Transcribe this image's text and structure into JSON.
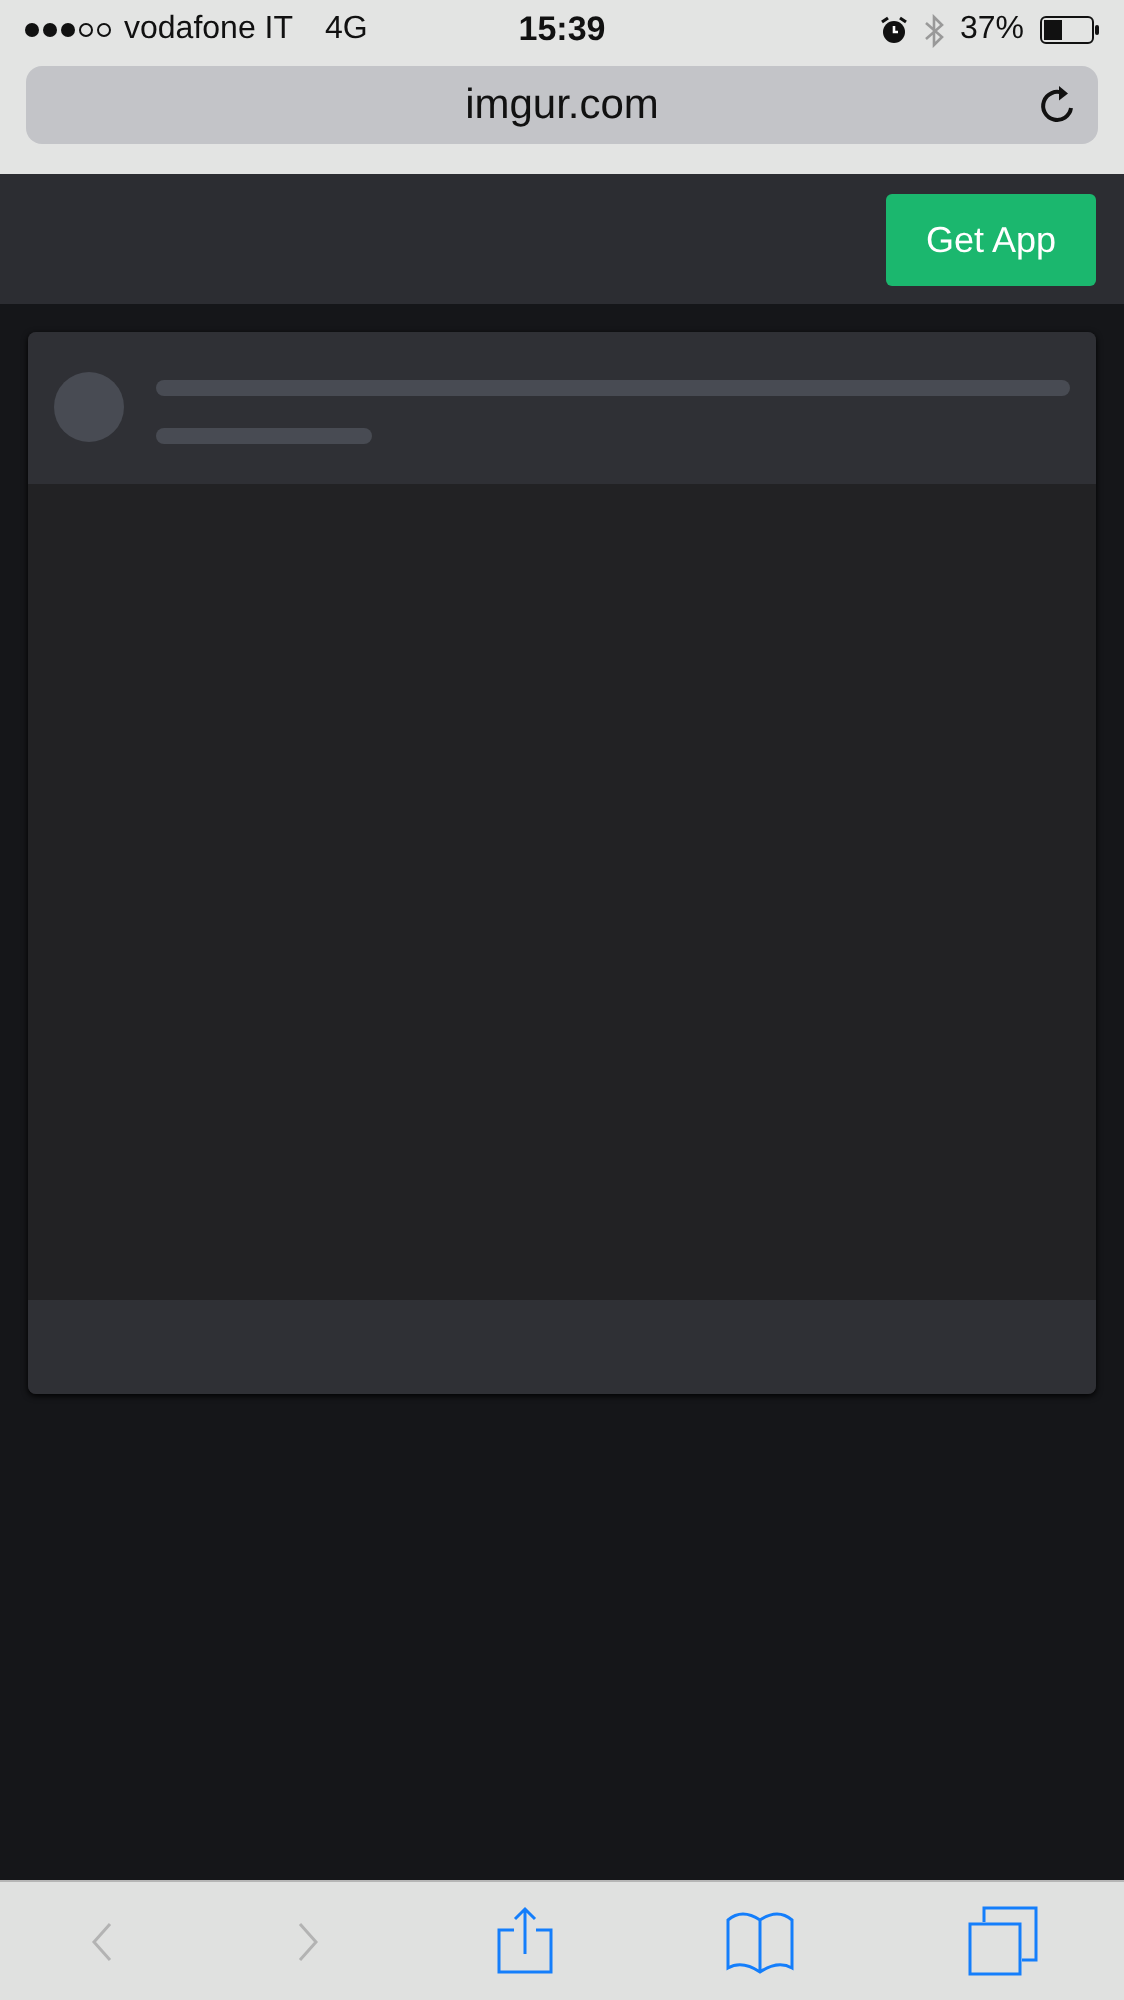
{
  "status_bar": {
    "carrier": "vodafone IT",
    "network": "4G",
    "time": "15:39",
    "battery": "37%"
  },
  "address_bar": {
    "url": "imgur.com"
  },
  "header": {
    "button": "Get App"
  },
  "toolbar": [
    {
      "kind": "back",
      "disabled": true
    },
    {
      "kind": "forward",
      "disabled": true
    },
    {
      "kind": "share",
      "disabled": false
    },
    {
      "kind": "bookmarks",
      "disabled": false
    },
    {
      "kind": "tabs",
      "disabled": false
    }
  ]
}
